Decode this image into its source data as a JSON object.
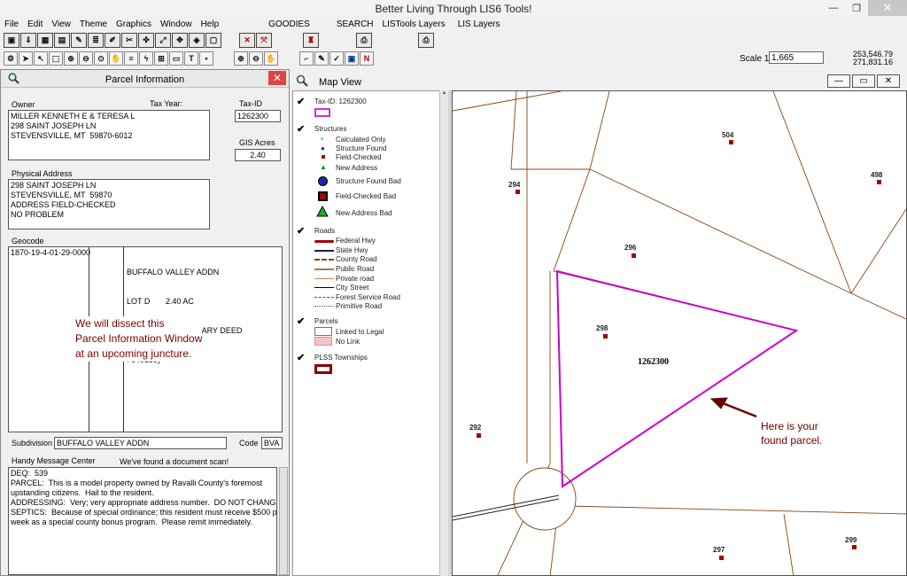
{
  "app": {
    "title": "Better Living Through LIS6 Tools!",
    "minimize": "—",
    "restore": "❐",
    "close": "✕"
  },
  "menu": [
    "File",
    "Edit",
    "View",
    "Theme",
    "Graphics",
    "Window",
    "Help",
    "GOODIES",
    "SEARCH",
    "LISTools Layers",
    "LIS  Layers"
  ],
  "scale": {
    "label": "Scale 1:",
    "value": "1,665"
  },
  "coords": {
    "x": "253,546.79",
    "y": "271,831.16"
  },
  "parcel_info": {
    "title": "Parcel Information",
    "close": "✕",
    "owner_label": "Owner",
    "tax_year_label": "Tax Year:",
    "tax_id_label": "Tax-ID",
    "tax_id": "1262300",
    "owner_lines": [
      "MILLER KENNETH E & TERESA L",
      "",
      "298 SAINT JOSEPH LN",
      "",
      "STEVENSVILLE, MT  59870-6012"
    ],
    "gis_acres_label": "GIS Acres",
    "gis_acres": "2.40",
    "physical_address_label": "Physical Address",
    "physical_address_lines": [
      "298 SAINT JOSEPH LN",
      "STEVENSVILLE, MT  59870",
      "",
      "ADDRESS FIELD-CHECKED",
      "NO PROBLEM"
    ],
    "geocode_label": "Geocode",
    "geocode": "1870-19-4-01-29-0000",
    "legal_lines": [
      "BUFFALO VALLEY ADDN",
      "LOT D       2.40 AC",
      "(SUBJ TO BENEFICIARY DEED",
      "#649139)"
    ],
    "annotation_lines": [
      "We will dissect this",
      "Parcel Information Window",
      "at an upcoming juncture."
    ],
    "subdivision_label": "Subdivision",
    "subdivision": "BUFFALO VALLEY ADDN",
    "code_label": "Code",
    "code": "BVA",
    "message_center_label": "Handy Message Center",
    "message_status": "We've found a document scan!",
    "messages": [
      "DEQ:  539",
      "",
      "PARCEL:  This is a model property owned by Ravalli County's foremost",
      "upstanding citizens.  Hail to the resident.",
      "",
      "ADDRESSING:  Very; very appropriate address number.  DO NOT CHANGE.",
      "",
      "SEPTICS:  Because of special ordinance; this resident must receive $500 per",
      "week as a special county bonus program.  Please remit immediately."
    ]
  },
  "map_view": {
    "title": "Map View",
    "legend": {
      "tax_id": "Tax-ID: 1262300",
      "structures": "Structures",
      "structure_items": [
        "Calculated Only",
        "Structure Found",
        "Field-Checked",
        "New Address",
        "Structure Found Bad",
        "Field-Checked Bad",
        "New Address Bad"
      ],
      "roads": "Roads",
      "road_items": [
        "Federal Hwy",
        "State Hwy",
        "County Road",
        "Public Road",
        "Private road",
        "City Street",
        "Forest Service Road",
        "Primitive Road"
      ],
      "parcels": "Parcels",
      "parcel_items": [
        "Linked to Legal",
        "No Link"
      ],
      "plss": "PLSS Townships"
    },
    "parcel_labels": [
      "504",
      "498",
      "294",
      "296",
      "298",
      "292",
      "297",
      "299"
    ],
    "parcel_id": "1262300",
    "annotation_lines": [
      "Here is your",
      "found parcel."
    ]
  }
}
